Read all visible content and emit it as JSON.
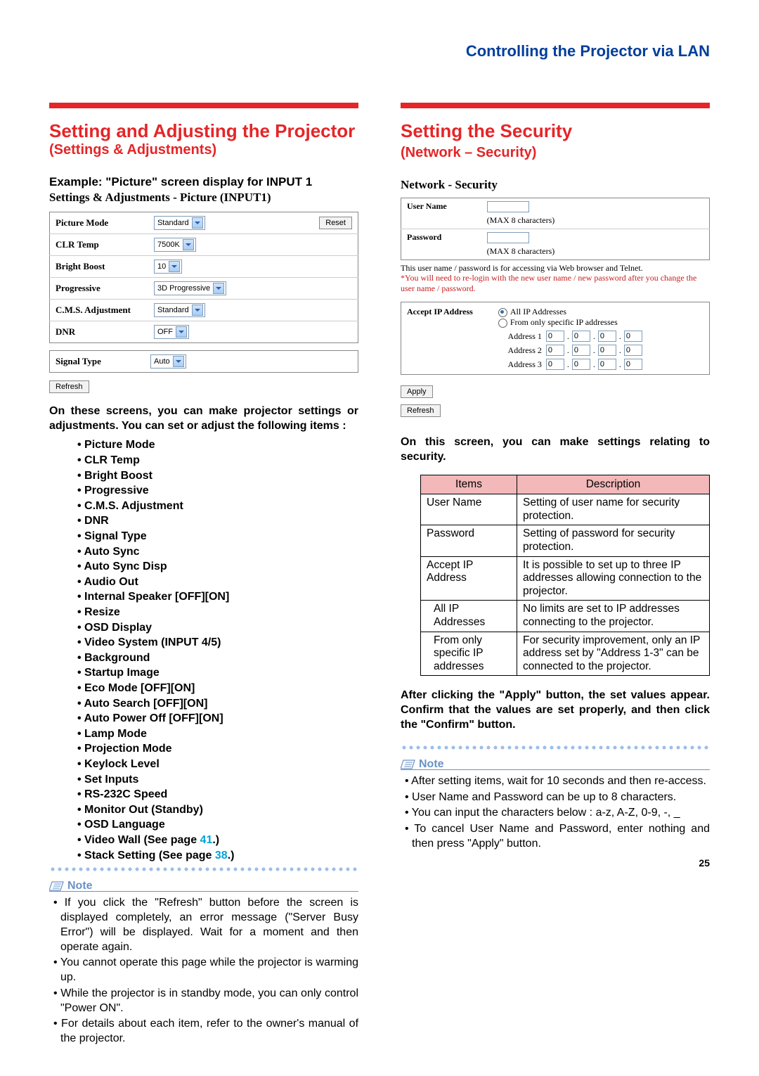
{
  "header": "Controlling the Projector via LAN",
  "pagenum": "25",
  "left": {
    "title": "Setting and Adjusting the Projector",
    "title_paren": "(Settings & Adjustments)",
    "example_line": "Example: \"Picture\" screen display for INPUT 1",
    "serif_sub": "Settings & Adjustments - Picture (INPUT1)",
    "ptable": {
      "rows": [
        {
          "label": "Picture Mode",
          "value": "Standard"
        },
        {
          "label": "CLR Temp",
          "value": "7500K"
        },
        {
          "label": "Bright Boost",
          "value": "10"
        },
        {
          "label": "Progressive",
          "value": "3D Progressive"
        },
        {
          "label": "C.M.S. Adjustment",
          "value": "Standard"
        },
        {
          "label": "DNR",
          "value": "OFF"
        }
      ],
      "signal_label": "Signal Type",
      "signal_value": "Auto",
      "reset": "Reset"
    },
    "refresh": "Refresh",
    "body1": "On these screens, you can make projector settings or adjustments. You can set or adjust the following items :",
    "bullets": [
      "Picture Mode",
      "CLR Temp",
      "Bright Boost",
      "Progressive",
      "C.M.S. Adjustment",
      "DNR",
      "Signal Type",
      "Auto Sync",
      "Auto Sync Disp",
      "Audio Out",
      "Internal Speaker [OFF][ON]",
      "Resize",
      "OSD Display",
      "Video System (INPUT 4/5)",
      "Background",
      "Startup Image",
      "Eco Mode [OFF][ON]",
      "Auto Search [OFF][ON]",
      "Auto Power Off [OFF][ON]",
      "Lamp Mode",
      "Projection Mode",
      "Keylock Level",
      "Set Inputs",
      "RS-232C Speed",
      "Monitor Out (Standby)",
      "OSD Language"
    ],
    "video_wall_prefix": "Video Wall (See page ",
    "video_wall_page": "41",
    "stack_prefix": "Stack Setting (See page ",
    "stack_page": "38",
    "link_suffix": ".)",
    "note_label": "Note",
    "notes": [
      "If you click the \"Refresh\" button before the screen is displayed completely, an error message (\"Server Busy Error\") will be displayed. Wait for a moment and then operate again.",
      "You cannot operate this page while the projector is warming up.",
      "While the projector is in standby mode, you can only control \"Power ON\".",
      "For details about each item, refer to the owner's manual of the projector."
    ]
  },
  "right": {
    "title": "Setting the Security",
    "title_sub": "(Network – Security)",
    "sec_sub": "Network - Security",
    "user_label": "User Name",
    "pass_label": "Password",
    "max_hint": "(MAX 8 characters)",
    "access_note": "This user name / password is for accessing via Web browser and Telnet.",
    "red_note": "*You will need to re-login with the new user name / new password after you change the user name / password.",
    "accept_label": "Accept IP Address",
    "opt_all": "All IP Addresses",
    "opt_specific": "From only specific IP addresses",
    "addr1": "Address 1",
    "addr2": "Address 2",
    "addr3": "Address 3",
    "ip_zero": "0",
    "apply": "Apply",
    "refresh": "Refresh",
    "body1": "On this screen, you can make settings relating to security.",
    "desc_header_items": "Items",
    "desc_header_desc": "Description",
    "desc": [
      {
        "item": "User Name",
        "text": "Setting of user name for security protection."
      },
      {
        "item": "Password",
        "text": "Setting of password for security protection."
      },
      {
        "item": "Accept IP Address",
        "text": "It is possible to set up to three IP addresses allowing connection to the projector."
      },
      {
        "item": "All IP Addresses",
        "indent": true,
        "text": "No limits are set to IP addresses connecting to the projector."
      },
      {
        "item": "From only specific IP addresses",
        "indent": true,
        "text": "For security improvement, only an IP address set by \"Address 1-3\" can be connected to the projector."
      }
    ],
    "body2": "After clicking the \"Apply\" button, the set values appear. Confirm that the values are set properly, and then click the \"Confirm\" button.",
    "note_label": "Note",
    "notes": [
      "After setting items, wait for 10 seconds and then re-access.",
      "User Name and Password can be up to 8 characters.",
      "You can input the characters below : a-z, A-Z, 0-9, -, _",
      "To cancel User Name and Password, enter nothing and then press \"Apply\" button."
    ]
  }
}
